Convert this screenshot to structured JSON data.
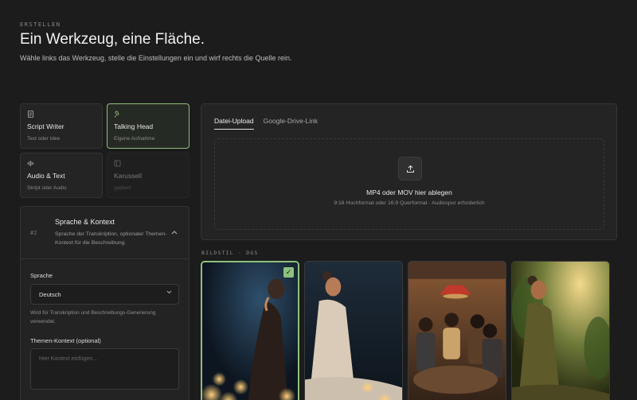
{
  "header": {
    "eyebrow": "ERSTELLEN",
    "title": "Ein Werkzeug, eine Fläche.",
    "subtitle": "Wähle links das Werkzeug, stelle die Einstellungen ein und wirf rechts die Quelle rein."
  },
  "tools": [
    {
      "label": "Script Writer",
      "sub": "Text oder Idee",
      "icon": "document-icon",
      "state": "default"
    },
    {
      "label": "Talking Head",
      "sub": "Eigene Aufnahme",
      "icon": "microphone-icon",
      "state": "active"
    },
    {
      "label": "Audio & Text",
      "sub": "Skript oder Audio",
      "icon": "waveform-icon",
      "state": "default"
    },
    {
      "label": "Karussell",
      "sub": "geplant",
      "icon": "carousel-icon",
      "state": "disabled"
    }
  ],
  "language_panel": {
    "step": "#2",
    "title": "Sprache & Kontext",
    "description": "Sprache der Transkription, optionaler Themen-Kontext für die Beschreibung.",
    "language_label": "Sprache",
    "language_value": "Deutsch",
    "language_hint": "Wird für Transkription und Beschreibungs-Generierung verwendet.",
    "context_label": "Themen-Kontext (optional)",
    "context_placeholder": "Hier Kontext einfügen..."
  },
  "upload": {
    "tabs": [
      "Datei-Upload",
      "Google-Drive-Link"
    ],
    "active_tab": 0,
    "drop_title": "MP4 oder MOV hier ablegen",
    "drop_sub": "9:16 Hochformat oder 16:9 Querformat · Audiospur erforderlich"
  },
  "image_style": {
    "label": "BILDSTIL · DGS",
    "selected_index": 0,
    "thumbnails": [
      "meditation-candles",
      "meditation-seated",
      "group-meeting",
      "meditation-garden"
    ]
  },
  "colors": {
    "accent": "#8fc17c",
    "background": "#1c1c1c",
    "panel": "#242424"
  }
}
